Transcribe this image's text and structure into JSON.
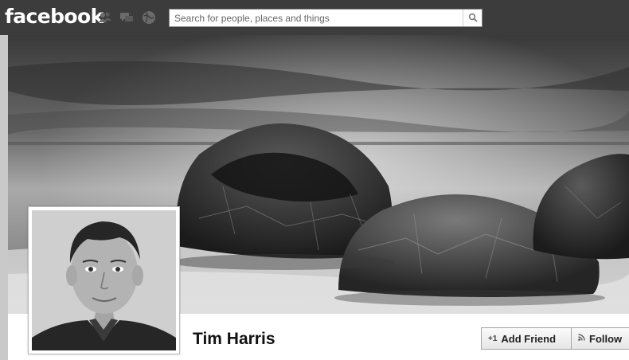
{
  "header": {
    "logo": "facebook",
    "icons": [
      "friend-requests-icon",
      "messages-icon",
      "notifications-icon"
    ],
    "search_placeholder": "Search for people, places and things",
    "search_icon": "magnifier-icon"
  },
  "profile": {
    "name": "Tim Harris",
    "add_friend_icon": "+1",
    "add_friend_label": "Add Friend",
    "follow_icon": "⁠ℷ",
    "follow_label": "Follow"
  },
  "colors": {
    "topbar": "#3c3c3c",
    "page": "#ffffff",
    "button_border": "#a5a5a5"
  }
}
